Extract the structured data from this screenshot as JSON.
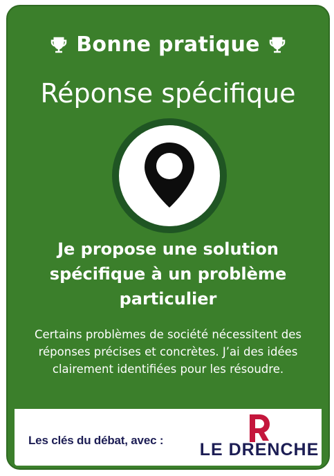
{
  "header": {
    "label": "Bonne pratique",
    "icons": [
      "trophy-icon",
      "trophy-icon"
    ]
  },
  "title": "Réponse spécifique",
  "icon": "map-pin-icon",
  "headline": "Je propose une solution spécifique à un problème particulier",
  "description": "Certains problèmes de société nécessitent des réponses précises et concrètes. J’ai des idées clairement identifiées pour les résoudre.",
  "footer": {
    "text": "Les clés du débat, avec :",
    "brand": "LE DRENCHE"
  },
  "colors": {
    "card": "#3b7f2b",
    "circle_ring": "#1f5523",
    "brand": "#1c1d54",
    "logo": "#c4163c"
  }
}
